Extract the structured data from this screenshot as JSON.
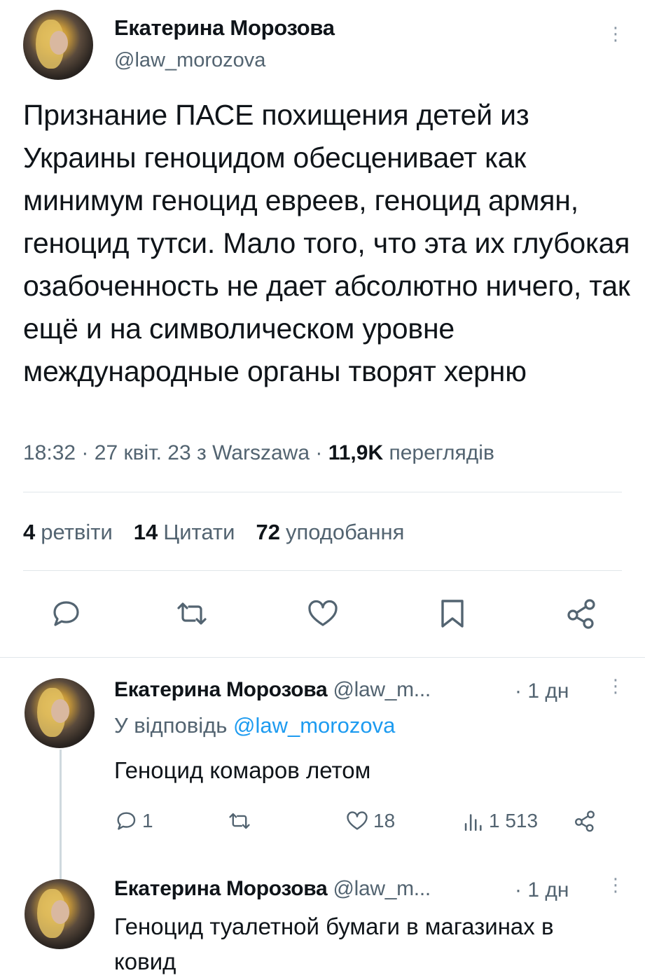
{
  "main_tweet": {
    "author_name": "Екатерина Морозова",
    "author_handle": "@law_morozova",
    "text": "Признание ПАСЕ похищения детей из Украины геноцидом обесценивает как минимум геноцид евреев, геноцид армян, геноцид тутси. Мало того, что эта их глубокая озабоченность не дает абсолютно ничего, так ещё и на символическом уровне международные органы творят херню",
    "time": "18:32",
    "date": "27 квіт. 23",
    "location_prefix": "з",
    "location": "Warszawa",
    "views_count": "11,9K",
    "views_label": "переглядів",
    "separator": "·",
    "stats": {
      "retweets_count": "4",
      "retweets_label": "ретвіти",
      "quotes_count": "14",
      "quotes_label": "Цитати",
      "likes_count": "72",
      "likes_label": "уподобання"
    },
    "actions": [
      "reply-icon",
      "retweet-icon",
      "like-icon",
      "bookmark-icon",
      "share-icon"
    ]
  },
  "replies": [
    {
      "author_name": "Екатерина Морозова",
      "author_handle": "@law_m...",
      "time": "· 1 дн",
      "reply_to_prefix": "У відповідь",
      "reply_to_handle": "@law_morozova",
      "text": "Геноцид комаров летом",
      "reply_count": "1",
      "retweet_count": "",
      "like_count": "18",
      "views_count": "1 513"
    },
    {
      "author_name": "Екатерина Морозова",
      "author_handle": "@law_m...",
      "time": "· 1 дн",
      "text": "Геноцид туалетной бумаги в магазинах в ковид"
    }
  ],
  "colors": {
    "text": "#0f1419",
    "secondary": "#536471",
    "link": "#1d9bf0",
    "divider": "#e1e6ea"
  }
}
